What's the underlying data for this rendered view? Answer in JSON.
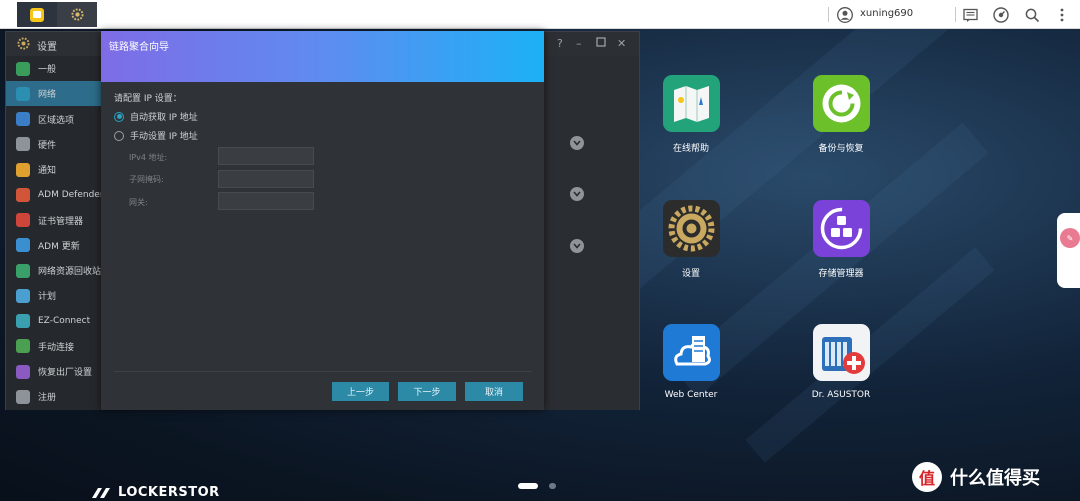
{
  "topbar": {
    "username": "xuning690",
    "taskbar_apps": [
      "file-explorer-icon",
      "settings-gear-icon"
    ],
    "right_icons": [
      "notification-list-icon",
      "system-monitor-icon",
      "search-icon",
      "more-icon"
    ]
  },
  "settings_window": {
    "title": "设置",
    "sidebar": {
      "items": [
        {
          "label": "一般",
          "icon": "general-icon",
          "color": "#3a9c5a"
        },
        {
          "label": "网络",
          "icon": "network-icon",
          "color": "#2a8fb0"
        },
        {
          "label": "区域选项",
          "icon": "region-icon",
          "color": "#3b7ec8"
        },
        {
          "label": "硬件",
          "icon": "hardware-icon",
          "color": "#8d9399"
        },
        {
          "label": "通知",
          "icon": "notification-icon",
          "color": "#e0a030"
        },
        {
          "label": "ADM Defender",
          "icon": "defender-icon",
          "color": "#d2553a"
        },
        {
          "label": "证书管理器",
          "icon": "certificate-icon",
          "color": "#d0453a"
        },
        {
          "label": "ADM 更新",
          "icon": "update-icon",
          "color": "#3a8fd0"
        },
        {
          "label": "网络资源回收站",
          "icon": "recycle-bin-icon",
          "color": "#3aa06a"
        },
        {
          "label": "计划",
          "icon": "schedule-icon",
          "color": "#4a9fd0"
        },
        {
          "label": "EZ-Connect",
          "icon": "ez-connect-icon",
          "color": "#3aa0b0"
        },
        {
          "label": "手动连接",
          "icon": "manual-connect-icon",
          "color": "#4aa050"
        },
        {
          "label": "恢复出厂设置",
          "icon": "factory-reset-icon",
          "color": "#8a5ac0"
        },
        {
          "label": "注册",
          "icon": "register-icon",
          "color": "#8d9399"
        }
      ],
      "selected_index": 1
    }
  },
  "wizard": {
    "title": "链路聚合向导",
    "prompt": "请配置 IP 设置：",
    "options": [
      {
        "label": "自动获取 IP 地址",
        "checked": true
      },
      {
        "label": "手动设置 IP 地址",
        "checked": false
      }
    ],
    "fields": [
      {
        "label": "IPv4 地址:",
        "value": ""
      },
      {
        "label": "子网掩码:",
        "value": ""
      },
      {
        "label": "网关:",
        "value": ""
      }
    ],
    "buttons": {
      "back": "上一步",
      "next": "下一步",
      "cancel": "取消"
    }
  },
  "desktop": {
    "apps": [
      {
        "label": "在线帮助",
        "icon": "online-help-icon",
        "color": "#22a37a"
      },
      {
        "label": "备份与恢复",
        "icon": "backup-restore-icon",
        "color": "#6cc02a"
      },
      {
        "label": "设置",
        "icon": "settings-icon",
        "color": "#2c2c2c"
      },
      {
        "label": "存储管理器",
        "icon": "storage-manager-icon",
        "color": "#7a42d8"
      },
      {
        "label": "Web Center",
        "icon": "web-center-icon",
        "color": "#1f7ad6"
      },
      {
        "label": "Dr. ASUSTOR",
        "icon": "dr-asustor-icon",
        "color": "#f1f3f5"
      }
    ],
    "page_indicator": {
      "count": 2,
      "active": 0
    },
    "brand": "LOCKERSTOR",
    "watermark": {
      "badge": "值",
      "text": "什么值得买"
    }
  }
}
